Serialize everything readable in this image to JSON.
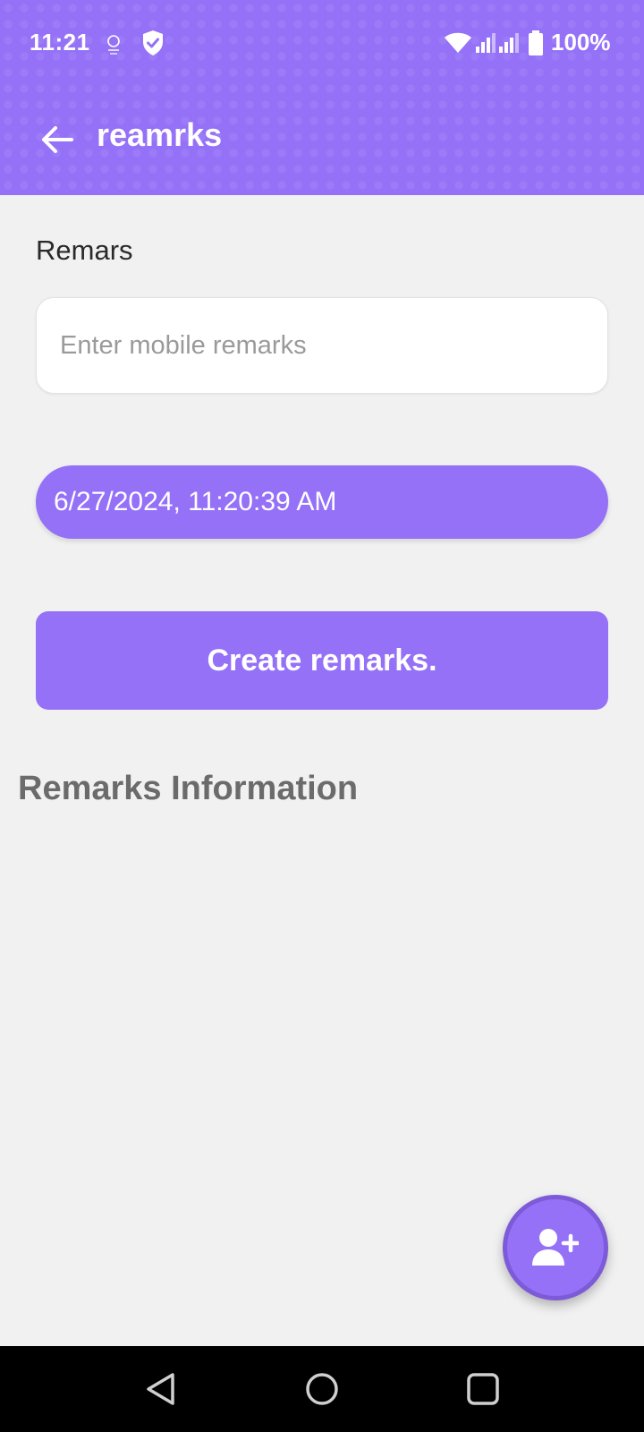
{
  "status_bar": {
    "time": "11:21",
    "battery": "100%",
    "icons": [
      "notification-icon",
      "shield-check-icon",
      "wifi-icon",
      "signal-icon",
      "signal-icon",
      "battery-icon"
    ]
  },
  "toolbar": {
    "title": "reamrks",
    "back_icon": "arrow-left-icon"
  },
  "form": {
    "label": "Remars",
    "remarks_placeholder": "Enter mobile remarks",
    "remarks_value": "",
    "datetime": "6/27/2024, 11:20:39 AM",
    "create_button_label": "Create remarks."
  },
  "section": {
    "title": "Remarks Information"
  },
  "fab": {
    "icon": "add-user-icon"
  },
  "nav": {
    "icons": [
      "back-triangle-icon",
      "home-circle-icon",
      "recents-square-icon"
    ]
  },
  "colors": {
    "accent": "#9571f7",
    "fab_border": "#7d5bd8",
    "background": "#f1f1f1",
    "section_title": "#6b6b6b"
  }
}
